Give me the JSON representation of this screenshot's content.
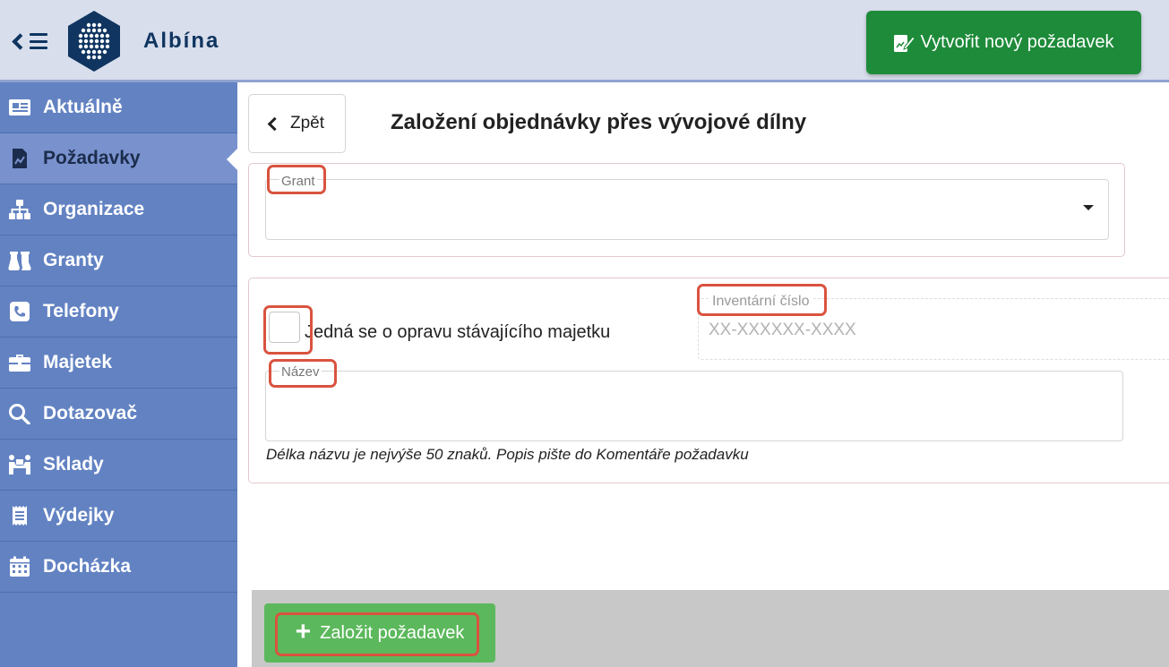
{
  "header": {
    "brand": "Albína",
    "new_request_label": "Vytvořit nový požadavek"
  },
  "sidebar": {
    "items": [
      {
        "label": "Aktuálně",
        "icon": "newspaper-icon"
      },
      {
        "label": "Požadavky",
        "icon": "file-chart-icon"
      },
      {
        "label": "Organizace",
        "icon": "sitemap-icon"
      },
      {
        "label": "Granty",
        "icon": "flask-icon"
      },
      {
        "label": "Telefony",
        "icon": "phone-icon"
      },
      {
        "label": "Majetek",
        "icon": "briefcase-icon"
      },
      {
        "label": "Dotazovač",
        "icon": "search-icon"
      },
      {
        "label": "Sklady",
        "icon": "people-carry-icon"
      },
      {
        "label": "Výdejky",
        "icon": "receipt-icon"
      },
      {
        "label": "Docházka",
        "icon": "calendar-icon"
      }
    ],
    "active": "Požadavky"
  },
  "page": {
    "back_label": "Zpět",
    "title": "Založení objednávky přes vývojové dílny"
  },
  "form": {
    "grant": {
      "label": "Grant",
      "value": ""
    },
    "repair_checkbox": {
      "label": "Jedná se o opravu stávajícího majetku",
      "checked": false
    },
    "inventory_number": {
      "label": "Inventární číslo",
      "placeholder": "XX-XXXXXX-XXXX",
      "value": ""
    },
    "name": {
      "label": "Název",
      "value": ""
    },
    "name_hint": "Délka názvu je nejvýše 50 znaků. Popis pište do Komentáře požadavku",
    "submit_label": "Založit požadavek"
  },
  "colors": {
    "header_bg": "#d9deec",
    "sidebar_bg": "#6282c2",
    "primary_green": "#1e8b3a",
    "submit_green": "#5cb85c",
    "highlight": "#d9533f"
  }
}
